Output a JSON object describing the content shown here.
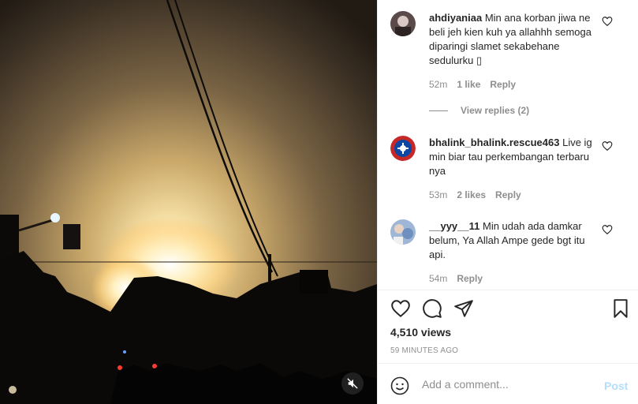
{
  "video": {
    "mute_icon": "speaker-muted-icon"
  },
  "comments": [
    {
      "username": "ahdiyaniaa",
      "text": "Min ana korban jiwa ne beli jeh kien kuh ya allahhh semoga diparingi slamet sekabehane sedulurku ▯",
      "time": "52m",
      "likes": "1 like",
      "reply_label": "Reply",
      "view_replies": "View replies (2)"
    },
    {
      "username": "bhalink_bhalink.rescue463",
      "text": "Live ig min biar tau perkembangan terbaru nya",
      "time": "53m",
      "likes": "2 likes",
      "reply_label": "Reply"
    },
    {
      "username": "__yyy__11",
      "text": "Min udah ada damkar belum, Ya Allah Ampe gede bgt itu api.",
      "time": "54m",
      "reply_label": "Reply"
    }
  ],
  "actions": {
    "icons": [
      "heart-icon",
      "comment-icon",
      "share-icon",
      "bookmark-icon"
    ],
    "views": "4,510 views",
    "posted": "59 MINUTES AGO"
  },
  "add_comment": {
    "placeholder": "Add a comment...",
    "post_label": "Post"
  },
  "colors": {
    "link_blue_disabled": "#b2dffc",
    "secondary_text": "#8e8e8e",
    "border": "#efefef"
  }
}
